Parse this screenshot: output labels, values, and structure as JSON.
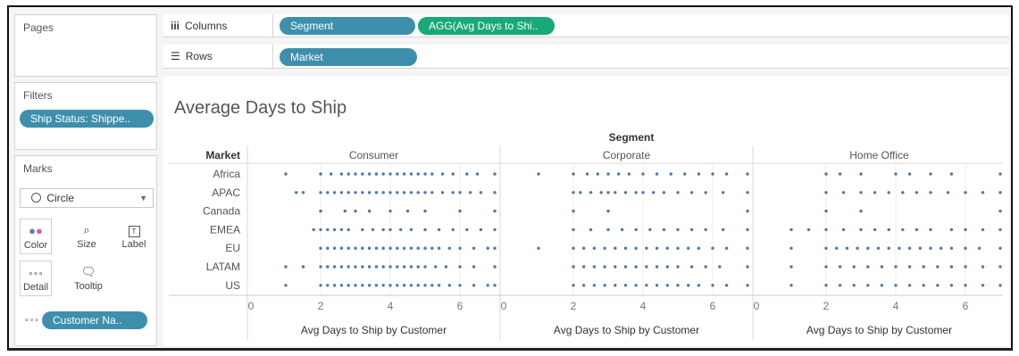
{
  "pages_panel": {
    "title": "Pages"
  },
  "filters_panel": {
    "title": "Filters",
    "pill": "Ship Status: Shippe.."
  },
  "marks_panel": {
    "title": "Marks",
    "mark_type": "Circle",
    "buttons": {
      "color": "Color",
      "size": "Size",
      "label": "Label",
      "detail": "Detail",
      "tooltip": "Tooltip"
    },
    "detail_pill": "Customer Na.."
  },
  "columns_shelf": {
    "label": "Columns",
    "pills": [
      "Segment",
      "AGG(Avg Days to Shi.."
    ]
  },
  "rows_shelf": {
    "label": "Rows",
    "pills": [
      "Market"
    ]
  },
  "view": {
    "title": "Average Days to Ship",
    "column_header": "Segment",
    "row_header": "Market",
    "segments": [
      "Consumer",
      "Corporate",
      "Home Office"
    ],
    "markets": [
      "Africa",
      "APAC",
      "Canada",
      "EMEA",
      "EU",
      "LATAM",
      "US"
    ],
    "ticks": [
      "0",
      "2",
      "4",
      "6"
    ],
    "axis_title": "Avg Days to Ship by Customer"
  },
  "colors": {
    "accent_blue": "#3d8fac",
    "accent_green": "#17a978",
    "mark": "#4e79a7"
  },
  "chart_data": {
    "type": "scatter",
    "title": "Average Days to Ship",
    "xlabel": "Avg Days to Ship by Customer",
    "xlim": [
      0,
      7
    ],
    "columns": [
      "Consumer",
      "Corporate",
      "Home Office"
    ],
    "rows": [
      "Africa",
      "APAC",
      "Canada",
      "EMEA",
      "EU",
      "LATAM",
      "US"
    ],
    "series": [
      {
        "segment": "Consumer",
        "market": "Africa",
        "values": [
          1.0,
          2.0,
          2.3,
          2.6,
          2.8,
          3.0,
          3.2,
          3.4,
          3.6,
          3.8,
          4.0,
          4.2,
          4.4,
          4.6,
          4.8,
          5.0,
          5.2,
          5.5,
          5.8,
          6.2,
          6.5,
          7.0
        ]
      },
      {
        "segment": "Consumer",
        "market": "APAC",
        "values": [
          1.3,
          1.5,
          2.0,
          2.2,
          2.4,
          2.6,
          2.8,
          3.0,
          3.2,
          3.4,
          3.6,
          3.8,
          4.0,
          4.2,
          4.4,
          4.6,
          4.8,
          5.0,
          5.2,
          5.5,
          5.8,
          6.0,
          6.3,
          6.6,
          7.0
        ]
      },
      {
        "segment": "Consumer",
        "market": "Canada",
        "values": [
          2.0,
          2.7,
          3.0,
          3.4,
          4.0,
          4.5,
          5.0,
          6.0,
          7.0
        ]
      },
      {
        "segment": "Consumer",
        "market": "EMEA",
        "values": [
          1.8,
          2.0,
          2.2,
          2.4,
          2.6,
          2.8,
          3.2,
          3.5,
          3.8,
          4.0,
          4.3,
          4.6,
          5.0,
          5.4,
          5.8,
          6.2,
          6.6,
          7.0
        ]
      },
      {
        "segment": "Consumer",
        "market": "EU",
        "values": [
          2.0,
          2.2,
          2.4,
          2.6,
          2.8,
          3.0,
          3.2,
          3.4,
          3.6,
          3.8,
          4.0,
          4.2,
          4.4,
          4.6,
          4.8,
          5.0,
          5.2,
          5.4,
          5.7,
          6.0,
          6.4,
          6.8,
          7.0
        ]
      },
      {
        "segment": "Consumer",
        "market": "LATAM",
        "values": [
          1.0,
          1.5,
          2.0,
          2.2,
          2.4,
          2.6,
          2.8,
          3.0,
          3.2,
          3.4,
          3.6,
          3.8,
          4.0,
          4.2,
          4.4,
          4.6,
          4.8,
          5.0,
          5.3,
          5.6,
          6.0,
          6.4,
          7.0
        ]
      },
      {
        "segment": "Consumer",
        "market": "US",
        "values": [
          1.0,
          2.0,
          2.2,
          2.4,
          2.6,
          2.8,
          3.0,
          3.2,
          3.4,
          3.6,
          3.8,
          4.0,
          4.2,
          4.4,
          4.6,
          4.8,
          5.0,
          5.2,
          5.4,
          5.7,
          6.0,
          6.4,
          6.8,
          7.0
        ]
      },
      {
        "segment": "Corporate",
        "market": "Africa",
        "values": [
          1.0,
          2.0,
          2.4,
          2.7,
          3.0,
          3.3,
          3.6,
          4.0,
          4.4,
          4.8,
          5.2,
          5.6,
          6.0,
          6.4,
          7.0
        ]
      },
      {
        "segment": "Corporate",
        "market": "APAC",
        "values": [
          2.0,
          2.2,
          2.5,
          2.8,
          3.0,
          3.2,
          3.5,
          3.8,
          4.0,
          4.3,
          4.6,
          5.0,
          5.4,
          5.8,
          6.3,
          7.0
        ]
      },
      {
        "segment": "Corporate",
        "market": "Canada",
        "values": [
          2.0,
          3.0,
          7.0
        ]
      },
      {
        "segment": "Corporate",
        "market": "EMEA",
        "values": [
          2.0,
          2.5,
          3.0,
          3.4,
          3.8,
          4.2,
          4.6,
          5.0,
          5.4,
          5.8,
          6.3,
          7.0
        ]
      },
      {
        "segment": "Corporate",
        "market": "EU",
        "values": [
          1.0,
          2.0,
          2.3,
          2.6,
          2.9,
          3.2,
          3.5,
          3.8,
          4.1,
          4.4,
          4.7,
          5.0,
          5.3,
          5.6,
          6.0,
          6.4,
          7.0
        ]
      },
      {
        "segment": "Corporate",
        "market": "LATAM",
        "values": [
          2.0,
          2.3,
          2.6,
          2.9,
          3.2,
          3.5,
          3.8,
          4.1,
          4.4,
          4.7,
          5.0,
          5.4,
          5.8,
          6.2,
          7.0
        ]
      },
      {
        "segment": "Corporate",
        "market": "US",
        "values": [
          2.0,
          2.3,
          2.6,
          2.9,
          3.2,
          3.5,
          3.8,
          4.1,
          4.4,
          4.7,
          5.0,
          5.3,
          5.6,
          6.0,
          6.4,
          7.0
        ]
      },
      {
        "segment": "Home Office",
        "market": "Africa",
        "values": [
          2.0,
          2.4,
          3.0,
          4.0,
          4.4,
          5.0,
          5.6,
          7.0
        ]
      },
      {
        "segment": "Home Office",
        "market": "APAC",
        "values": [
          2.0,
          2.5,
          3.0,
          3.4,
          3.8,
          4.2,
          4.6,
          5.0,
          5.5,
          6.0,
          6.5,
          7.0
        ]
      },
      {
        "segment": "Home Office",
        "market": "Canada",
        "values": [
          2.0,
          3.0,
          7.0
        ]
      },
      {
        "segment": "Home Office",
        "market": "EMEA",
        "values": [
          1.0,
          1.5,
          2.0,
          2.5,
          3.0,
          3.4,
          3.8,
          4.2,
          4.6,
          5.0,
          5.6,
          6.0,
          6.5,
          7.0
        ]
      },
      {
        "segment": "Home Office",
        "market": "EU",
        "values": [
          1.0,
          2.0,
          2.3,
          2.6,
          2.9,
          3.2,
          3.5,
          3.8,
          4.1,
          4.4,
          4.7,
          5.0,
          5.3,
          5.6,
          6.0,
          6.4,
          7.0
        ]
      },
      {
        "segment": "Home Office",
        "market": "LATAM",
        "values": [
          1.0,
          2.0,
          2.4,
          2.8,
          3.2,
          3.6,
          4.0,
          4.4,
          4.8,
          5.2,
          5.6,
          6.0,
          6.5,
          7.0
        ]
      },
      {
        "segment": "Home Office",
        "market": "US",
        "values": [
          1.0,
          2.0,
          2.4,
          2.8,
          3.2,
          3.6,
          4.0,
          4.4,
          4.8,
          5.2,
          5.6,
          6.0,
          6.5,
          7.0
        ]
      }
    ]
  }
}
